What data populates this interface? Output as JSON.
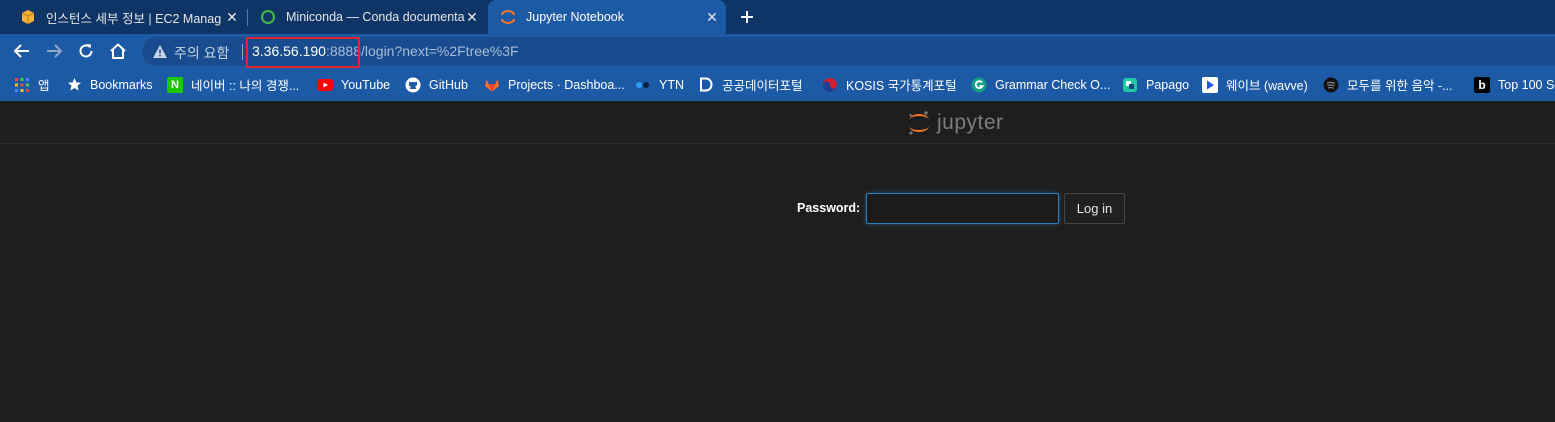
{
  "tabs": [
    {
      "title": "인스턴스 세부 정보 | EC2 Manag",
      "icon": "aws-box-icon"
    },
    {
      "title": "Miniconda — Conda documenta",
      "icon": "loading-ring-icon"
    },
    {
      "title": "Jupyter Notebook",
      "icon": "jupyter-icon",
      "active": true
    }
  ],
  "address_bar": {
    "warning_text": "주의 요함",
    "url_host": "3.36.56.190",
    "url_rest": ":8888/login?next=%2Ftree%3F"
  },
  "bookmarks": [
    {
      "label": "앱",
      "icon": "apps-grid-icon"
    },
    {
      "label": "Bookmarks",
      "icon": "star-icon"
    },
    {
      "label": "네이버 :: 나의 경쟁...",
      "icon": "naver-icon"
    },
    {
      "label": "YouTube",
      "icon": "youtube-icon"
    },
    {
      "label": "GitHub",
      "icon": "github-icon"
    },
    {
      "label": "Projects · Dashboa...",
      "icon": "gitlab-icon"
    },
    {
      "label": "YTN",
      "icon": "ytn-icon"
    },
    {
      "label": "공공데이터포털",
      "icon": "data-portal-icon"
    },
    {
      "label": "KOSIS 국가통계포털",
      "icon": "kosis-icon"
    },
    {
      "label": "Grammar Check O...",
      "icon": "grammar-icon"
    },
    {
      "label": "Papago",
      "icon": "papago-icon"
    },
    {
      "label": "웨이브 (wavve)",
      "icon": "wavve-icon"
    },
    {
      "label": "모두를 위한 음악 -...",
      "icon": "spotify-icon"
    },
    {
      "label": "Top 100 So",
      "icon": "b-icon"
    }
  ],
  "jupyter": {
    "logo_text": "jupyter",
    "password_label": "Password:",
    "login_button": "Log in"
  },
  "colors": {
    "titlebar": "#0f3566",
    "toolbar": "#1d5aa6",
    "page_bg": "#1e1e1e",
    "highlight": "#e0262a",
    "jupyter_orange": "#f37626"
  }
}
